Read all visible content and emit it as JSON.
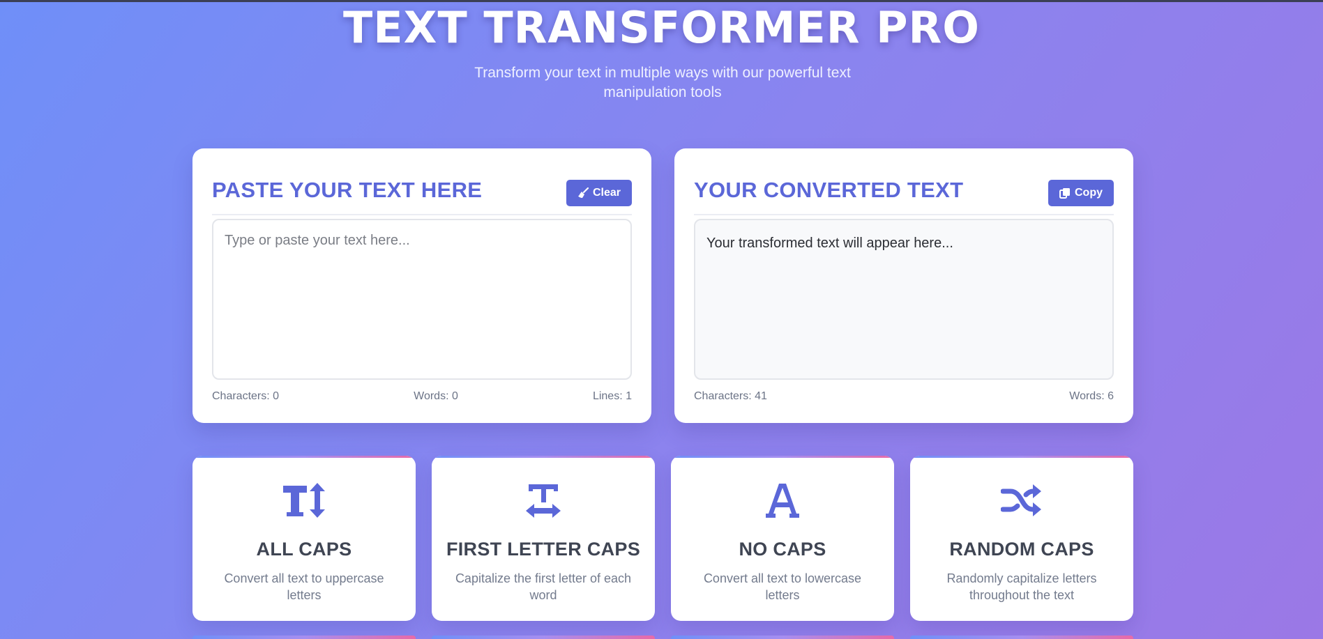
{
  "header": {
    "title": "TEXT TRANSFORMER PRO",
    "subtitle": "Transform your text in multiple ways with our powerful text manipulation tools"
  },
  "input_panel": {
    "title": "PASTE YOUR TEXT HERE",
    "clear_label": "Clear",
    "clear_icon": "broom-icon",
    "placeholder": "Type or paste your text here...",
    "value": "",
    "stats": {
      "characters": "Characters: 0",
      "words": "Words: 0",
      "lines": "Lines: 1"
    }
  },
  "output_panel": {
    "title": "YOUR CONVERTED TEXT",
    "copy_label": "Copy",
    "copy_icon": "copy-icon",
    "text": "Your transformed text will appear here...",
    "stats": {
      "characters": "Characters: 41",
      "words": "Words: 6"
    }
  },
  "tools": [
    {
      "title": "ALL CAPS",
      "description": "Convert all text to uppercase letters",
      "icon": "text-height-icon"
    },
    {
      "title": "FIRST LETTER CAPS",
      "description": "Capitalize the first letter of each word",
      "icon": "text-width-icon"
    },
    {
      "title": "NO CAPS",
      "description": "Convert all text to lowercase letters",
      "icon": "font-icon"
    },
    {
      "title": "RANDOM CAPS",
      "description": "Randomly capitalize letters throughout the text",
      "icon": "shuffle-icon"
    }
  ],
  "colors": {
    "accent": "#5b67d8",
    "gradient_start": "#6f8ff8",
    "gradient_end": "#9b78e6",
    "card_title": "#3f4553"
  }
}
